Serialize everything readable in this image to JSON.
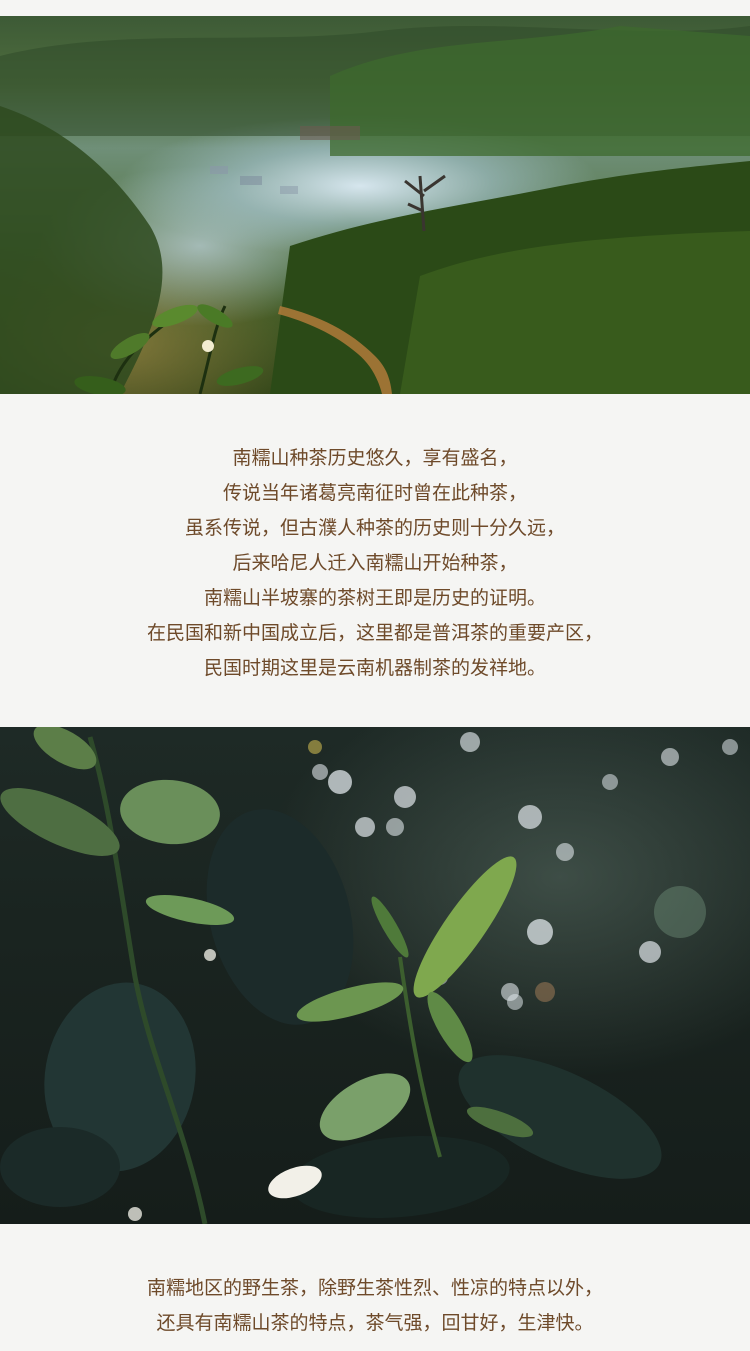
{
  "paragraph_1": [
    "南糯山种茶历史悠久，享有盛名，",
    "传说当年诸葛亮南征时曾在此种茶，",
    "虽系传说，但古濮人种茶的历史则十分久远，",
    "后来哈尼人迁入南糯山开始种茶，",
    "南糯山半坡寨的茶树王即是历史的证明。",
    "在民国和新中国成立后，这里都是普洱茶的重要产区，",
    "民国时期这里是云南机器制茶的发祥地。"
  ],
  "paragraph_2": [
    "南糯地区的野生茶，除野生茶性烈、性凉的特点以外，",
    "还具有南糯山茶的特点，茶气强，回甘好，生津快。"
  ],
  "colors": {
    "background": "#f5f5f3",
    "text": "#6e4a2a"
  }
}
